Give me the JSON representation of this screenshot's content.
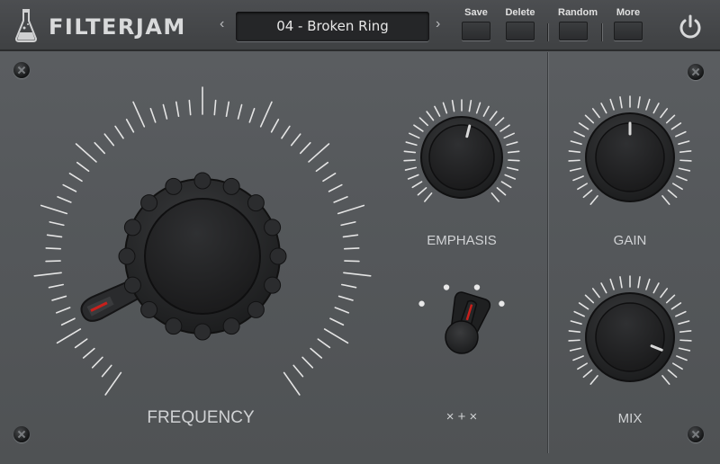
{
  "app": {
    "title": "FILTERJAM"
  },
  "preset": {
    "name": "04 - Broken Ring",
    "prev_symbol": "‹",
    "next_symbol": "›"
  },
  "toolbar": {
    "save_label": "Save",
    "delete_label": "Delete",
    "random_label": "Random",
    "more_label": "More"
  },
  "knobs": {
    "frequency": {
      "label": "FREQUENCY",
      "value": 0.1
    },
    "emphasis": {
      "label": "EMPHASIS",
      "value": 0.55
    },
    "gain": {
      "label": "GAIN",
      "value": 0.5
    },
    "mix": {
      "label": "MIX",
      "value": 0.9
    }
  },
  "multiplier": {
    "label": "× + ×",
    "position": 3,
    "positions": 4
  },
  "colors": {
    "background": "#55585b",
    "knob": "#262729",
    "pointer_red": "#c8201c",
    "tick": "#e4e4e4",
    "text": "#d0d2d4"
  },
  "icons": {
    "logo": "flask-icon",
    "power": "power-icon",
    "screws": "screw-icon"
  }
}
